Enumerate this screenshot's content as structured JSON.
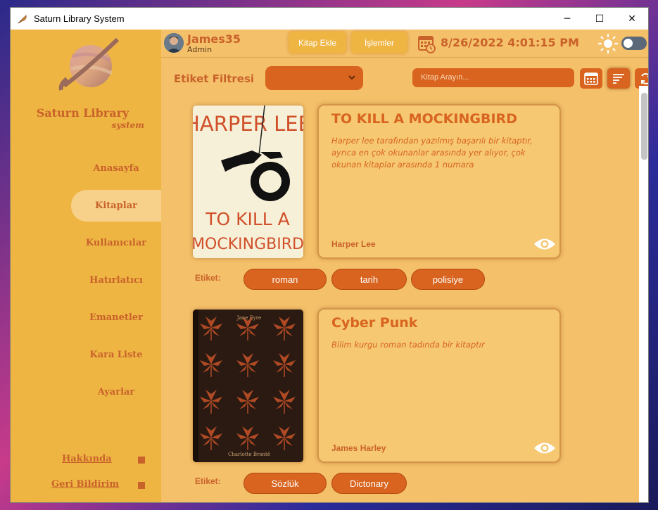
{
  "window": {
    "title": "Saturn Library System",
    "controls": {
      "minimize": "─",
      "maximize": "☐",
      "close": "✕"
    }
  },
  "sidebar": {
    "logo_title": "Saturn Library",
    "logo_subtitle": "system",
    "nav": [
      {
        "label": "Anasayfa",
        "active": false
      },
      {
        "label": "Kitaplar",
        "active": true
      },
      {
        "label": "Kullanıcılar",
        "active": false
      },
      {
        "label": "Hatırlatıcı",
        "active": false
      },
      {
        "label": "Emanetler",
        "active": false
      },
      {
        "label": "Kara Liste",
        "active": false
      },
      {
        "label": "Ayarlar",
        "active": false
      }
    ],
    "footer_links": [
      {
        "label": "Hakkında"
      },
      {
        "label": "Geri Bildirim"
      }
    ]
  },
  "header": {
    "user_name": "James35",
    "user_role": "Admin",
    "add_book_label": "Kitap Ekle",
    "actions_label": "İşlemler",
    "datetime": "8/26/2022 4:01:15 PM",
    "theme_toggle_on": false
  },
  "toolbar": {
    "filter_label": "Etiket Filtresi",
    "filter_value": "",
    "search_placeholder": "Kitap Arayın..."
  },
  "books": [
    {
      "cover_text": [
        "HARPER LEE",
        "TO KILL A",
        "MOCKINGBIRD"
      ],
      "title": "TO KILL A MOCKINGBIRD",
      "description": "Harper lee tarafından yazılmış başarılı bir kitaptır, ayrıca en çok okunanlar arasında yer alıyor, çok okunan kitaplar arasında 1 numara",
      "author": "Harper Lee",
      "tag_label": "Etiket:",
      "tags": [
        "roman",
        "tarih",
        "polisiye"
      ]
    },
    {
      "cover_text": [
        "Jane Eyre",
        "Charlotte Brontë"
      ],
      "title": "Cyber Punk",
      "description": "Bilim kurgu roman tadında bir kitaptır",
      "author": "James Harley",
      "tag_label": "Etiket:",
      "tags": [
        "Sözlük",
        "Dictonary"
      ]
    }
  ],
  "colors": {
    "accent": "#d8641f",
    "sidebar": "#eeb543",
    "background": "#f4c06a"
  }
}
